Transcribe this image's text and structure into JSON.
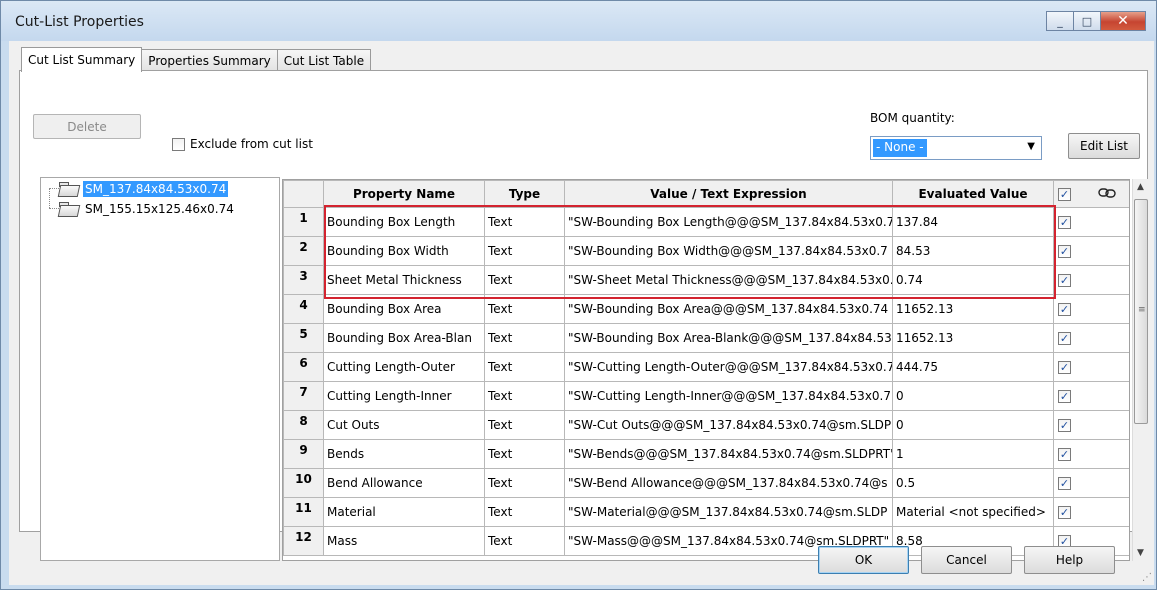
{
  "window": {
    "title": "Cut-List Properties",
    "minimize": "_",
    "maximize": "□",
    "close": "✕"
  },
  "tabs": [
    "Cut List Summary",
    "Properties Summary",
    "Cut List Table"
  ],
  "toolbar": {
    "delete_label": "Delete",
    "exclude_label": "Exclude from cut list",
    "bom_label": "BOM quantity:",
    "bom_value": "- None -",
    "edit_list_label": "Edit List"
  },
  "tree": {
    "items": [
      "SM_137.84x84.53x0.74",
      "SM_155.15x125.46x0.74"
    ]
  },
  "table": {
    "headers": [
      "Property Name",
      "Type",
      "Value / Text Expression",
      "Evaluated Value"
    ],
    "rows": [
      {
        "num": "1",
        "name": "Bounding Box Length",
        "type": "Text",
        "expr": "\"SW-Bounding Box Length@@@SM_137.84x84.53x0.7",
        "value": "137.84"
      },
      {
        "num": "2",
        "name": "Bounding Box Width",
        "type": "Text",
        "expr": "\"SW-Bounding Box Width@@@SM_137.84x84.53x0.7",
        "value": "84.53"
      },
      {
        "num": "3",
        "name": "Sheet Metal Thickness",
        "type": "Text",
        "expr": "\"SW-Sheet Metal Thickness@@@SM_137.84x84.53x0.",
        "value": "0.74"
      },
      {
        "num": "4",
        "name": "Bounding Box Area",
        "type": "Text",
        "expr": "\"SW-Bounding Box Area@@@SM_137.84x84.53x0.74",
        "value": "11652.13"
      },
      {
        "num": "5",
        "name": "Bounding Box Area-Blan",
        "type": "Text",
        "expr": "\"SW-Bounding Box Area-Blank@@@SM_137.84x84.53",
        "value": "11652.13"
      },
      {
        "num": "6",
        "name": "Cutting Length-Outer",
        "type": "Text",
        "expr": "\"SW-Cutting Length-Outer@@@SM_137.84x84.53x0.7",
        "value": "444.75"
      },
      {
        "num": "7",
        "name": "Cutting Length-Inner",
        "type": "Text",
        "expr": "\"SW-Cutting Length-Inner@@@SM_137.84x84.53x0.7",
        "value": "0"
      },
      {
        "num": "8",
        "name": "Cut Outs",
        "type": "Text",
        "expr": "\"SW-Cut Outs@@@SM_137.84x84.53x0.74@sm.SLDP",
        "value": "0"
      },
      {
        "num": "9",
        "name": "Bends",
        "type": "Text",
        "expr": "\"SW-Bends@@@SM_137.84x84.53x0.74@sm.SLDPRT\"",
        "value": "1"
      },
      {
        "num": "10",
        "name": "Bend Allowance",
        "type": "Text",
        "expr": "\"SW-Bend Allowance@@@SM_137.84x84.53x0.74@s",
        "value": "0.5"
      },
      {
        "num": "11",
        "name": "Material",
        "type": "Text",
        "expr": "\"SW-Material@@@SM_137.84x84.53x0.74@sm.SLDP",
        "value": "Material <not specified>"
      },
      {
        "num": "12",
        "name": "Mass",
        "type": "Text",
        "expr": "\"SW-Mass@@@SM_137.84x84.53x0.74@sm.SLDPRT\"",
        "value": "8.58"
      }
    ]
  },
  "footer": {
    "ok_label": "OK",
    "cancel_label": "Cancel",
    "help_label": "Help"
  },
  "colors": {
    "highlight_box": "#d3232f",
    "selection": "#3399ff"
  }
}
